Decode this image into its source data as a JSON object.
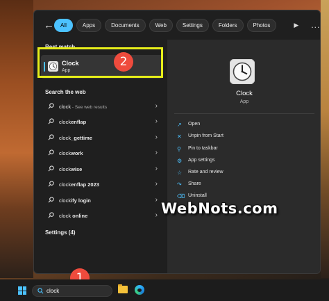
{
  "filters": {
    "chips": [
      "All",
      "Apps",
      "Documents",
      "Web",
      "Settings",
      "Folders",
      "Photos"
    ],
    "active": "All",
    "more": "..."
  },
  "best_match": {
    "title": "Best match",
    "name": "Clock",
    "type": "App"
  },
  "search_web": {
    "title": "Search the web",
    "items": [
      {
        "prefix": "clock",
        "bold": "",
        "sub": " - See web results"
      },
      {
        "prefix": "clock",
        "bold": "enflap",
        "sub": ""
      },
      {
        "prefix": "clock",
        "bold": "_gettime",
        "sub": ""
      },
      {
        "prefix": "clock",
        "bold": "work",
        "sub": ""
      },
      {
        "prefix": "clock",
        "bold": "wise",
        "sub": ""
      },
      {
        "prefix": "clock",
        "bold": "enflap 2023",
        "sub": ""
      },
      {
        "prefix": "clock",
        "bold": "ify login",
        "sub": ""
      },
      {
        "prefix": "clock",
        "bold": " online",
        "sub": ""
      }
    ]
  },
  "settings_count": "Settings (4)",
  "details": {
    "name": "Clock",
    "type": "App",
    "actions": [
      {
        "icon": "open-icon",
        "label": "Open"
      },
      {
        "icon": "unpin-icon",
        "label": "Unpin from Start"
      },
      {
        "icon": "pin-icon",
        "label": "Pin to taskbar"
      },
      {
        "icon": "gear-icon",
        "label": "App settings"
      },
      {
        "icon": "star-icon",
        "label": "Rate and review"
      },
      {
        "icon": "share-icon",
        "label": "Share"
      },
      {
        "icon": "trash-icon",
        "label": "Uninstall"
      }
    ]
  },
  "annotations": {
    "step1": "1",
    "step2": "2"
  },
  "watermark": "WebNots.com",
  "taskbar": {
    "search_query": "clock"
  },
  "colors": {
    "accent": "#4cc2ff",
    "callout_box": "#e6ee1a",
    "badge": "#ef4b3d"
  }
}
